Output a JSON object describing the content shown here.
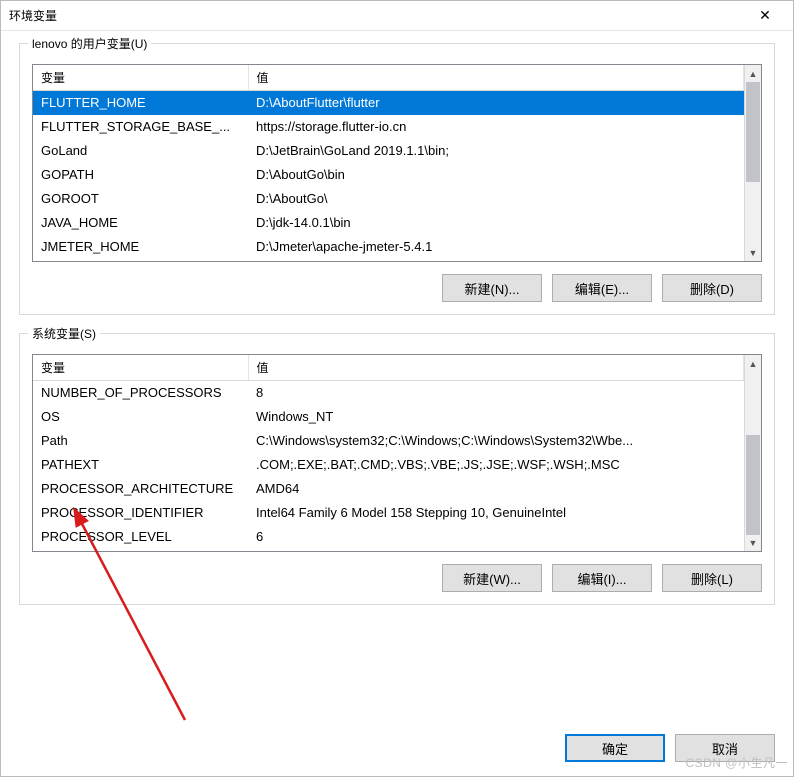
{
  "window": {
    "title": "环境变量"
  },
  "groups": {
    "user": {
      "label": "lenovo 的用户变量(U)",
      "columns": {
        "name": "变量",
        "value": "值"
      },
      "rows": [
        {
          "name": "FLUTTER_HOME",
          "value": "D:\\AboutFlutter\\flutter",
          "selected": true
        },
        {
          "name": "FLUTTER_STORAGE_BASE_...",
          "value": "https://storage.flutter-io.cn",
          "selected": false
        },
        {
          "name": "GoLand",
          "value": "D:\\JetBrain\\GoLand 2019.1.1\\bin;",
          "selected": false
        },
        {
          "name": "GOPATH",
          "value": "D:\\AboutGo\\bin",
          "selected": false
        },
        {
          "name": "GOROOT",
          "value": "D:\\AboutGo\\",
          "selected": false
        },
        {
          "name": "JAVA_HOME",
          "value": "D:\\jdk-14.0.1\\bin",
          "selected": false
        },
        {
          "name": "JMETER_HOME",
          "value": "D:\\Jmeter\\apache-jmeter-5.4.1",
          "selected": false
        }
      ],
      "buttons": {
        "new": "新建(N)...",
        "edit": "编辑(E)...",
        "delete": "删除(D)"
      }
    },
    "system": {
      "label": "系统变量(S)",
      "columns": {
        "name": "变量",
        "value": "值"
      },
      "rows": [
        {
          "name": "NUMBER_OF_PROCESSORS",
          "value": "8",
          "selected": false
        },
        {
          "name": "OS",
          "value": "Windows_NT",
          "selected": false
        },
        {
          "name": "Path",
          "value": "C:\\Windows\\system32;C:\\Windows;C:\\Windows\\System32\\Wbe...",
          "selected": false
        },
        {
          "name": "PATHEXT",
          "value": ".COM;.EXE;.BAT;.CMD;.VBS;.VBE;.JS;.JSE;.WSF;.WSH;.MSC",
          "selected": false
        },
        {
          "name": "PROCESSOR_ARCHITECTURE",
          "value": "AMD64",
          "selected": false
        },
        {
          "name": "PROCESSOR_IDENTIFIER",
          "value": "Intel64 Family 6 Model 158 Stepping 10, GenuineIntel",
          "selected": false
        },
        {
          "name": "PROCESSOR_LEVEL",
          "value": "6",
          "selected": false
        }
      ],
      "buttons": {
        "new": "新建(W)...",
        "edit": "编辑(I)...",
        "delete": "删除(L)"
      }
    }
  },
  "footer": {
    "ok": "确定",
    "cancel": "取消"
  },
  "watermark": "CSDN @小生凡一"
}
